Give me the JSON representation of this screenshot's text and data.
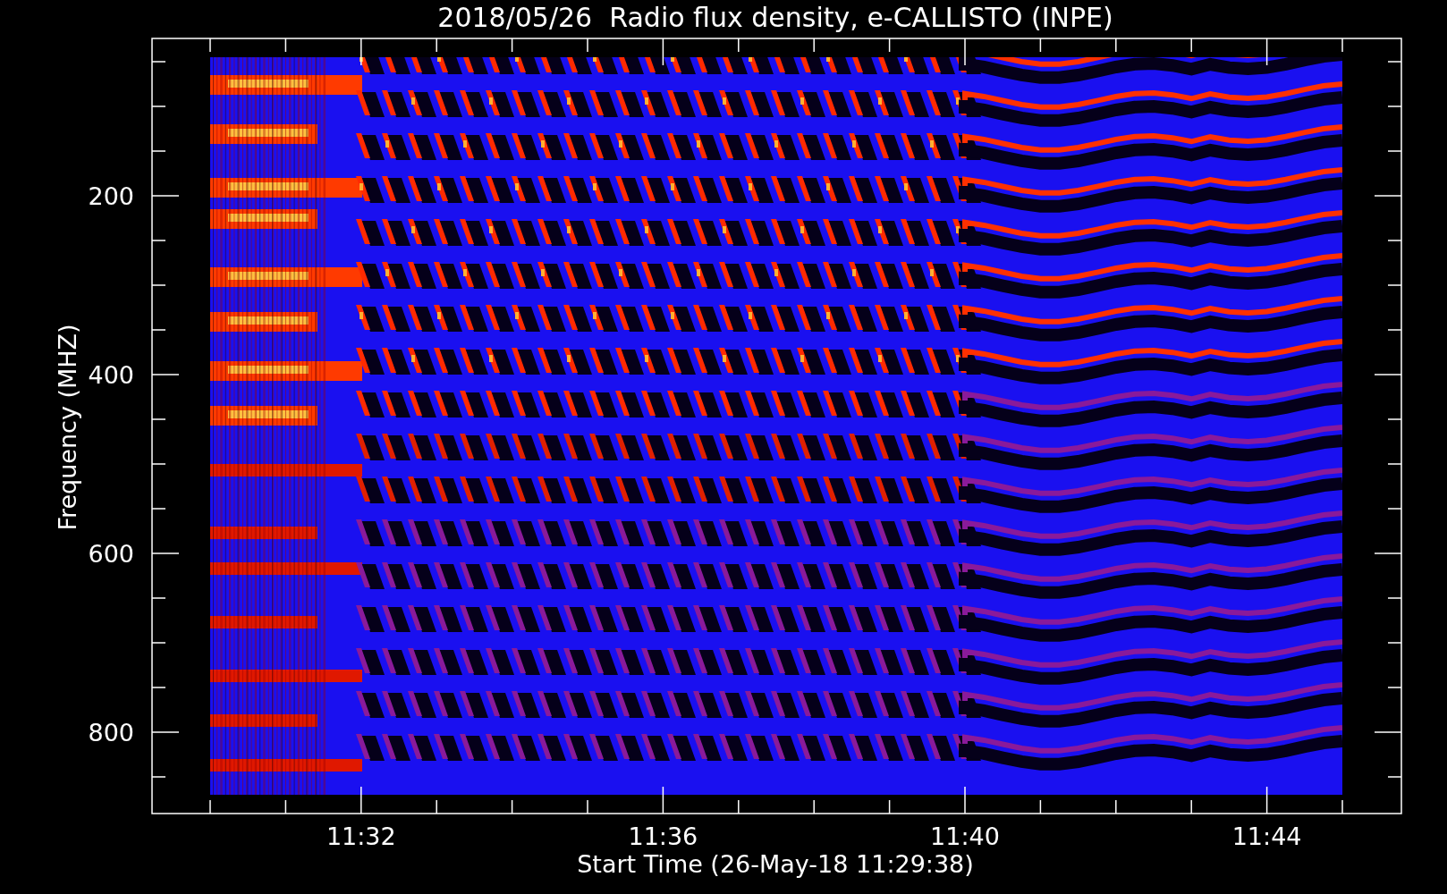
{
  "title": "2018/05/26  Radio flux density, e-CALLISTO (INPE)",
  "plot": {
    "xlabel": "Start Time (26-May-18 11:29:38)",
    "ylabel": "Frequency (MHZ)",
    "xtick_labels": [
      "11:32",
      "11:36",
      "11:40",
      "11:44"
    ],
    "ytick_labels": [
      "200",
      "400",
      "600",
      "800"
    ]
  }
}
